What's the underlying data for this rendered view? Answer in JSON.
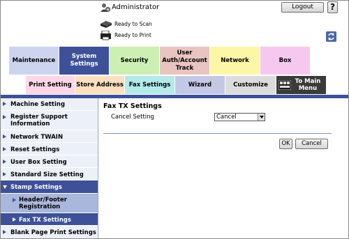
{
  "header": {
    "user_name": "Administrator",
    "logout_label": "Logout",
    "help_label": "?",
    "status": [
      {
        "text": "Ready to Scan",
        "icon": "scanner-icon"
      },
      {
        "text": "Ready to Print",
        "icon": "printer-icon"
      }
    ]
  },
  "categories": [
    {
      "label": "Maintenance",
      "bg": "#ccd4f0",
      "color": "#000000"
    },
    {
      "label": "System Settings",
      "bg": "#3d5098",
      "color": "#ffffff"
    },
    {
      "label": "Security",
      "bg": "#ccf0b4",
      "color": "#000000"
    },
    {
      "label": "User Auth/Account Track",
      "bg": "#e8c5c1",
      "color": "#000000"
    },
    {
      "label": "Network",
      "bg": "#fcf7a6",
      "color": "#000000"
    },
    {
      "label": "Box",
      "bg": "#f7c8ef",
      "color": "#000000"
    }
  ],
  "subtabs": [
    {
      "label": "Print Setting",
      "bg": "#fcd6e8",
      "color": "#000000"
    },
    {
      "label": "Store Address",
      "bg": "#fce0c0",
      "color": "#000000"
    },
    {
      "label": "Fax Settings",
      "bg": "#b4eaea",
      "color": "#000000"
    },
    {
      "label": "Wizard",
      "bg": "#c4c8e4",
      "color": "#000000"
    },
    {
      "label": "Customize",
      "bg": "#dcdcdc",
      "color": "#000000"
    },
    {
      "label": "To Main Menu",
      "bg": "#3a3a3a",
      "color": "#ffffff"
    }
  ],
  "sidebar": {
    "items": [
      {
        "label": "Machine Setting"
      },
      {
        "label": "Register Support Information"
      },
      {
        "label": "Network TWAIN"
      },
      {
        "label": "Reset Settings"
      },
      {
        "label": "User Box Setting"
      },
      {
        "label": "Standard Size Setting"
      },
      {
        "label": "Stamp Settings"
      },
      {
        "label": "Header/Footer Registration"
      },
      {
        "label": "Fax TX Settings"
      },
      {
        "label": "Blank Page Print Settings"
      }
    ]
  },
  "main": {
    "section_title": "Fax TX Settings",
    "cancel_setting_label": "Cancel Setting",
    "cancel_setting_value": "Cancel",
    "ok_label": "OK",
    "cancel_label": "Cancel"
  },
  "colors": {
    "accent": "#3d5098",
    "sidebar_bg": "#ecf1f9",
    "sidebar_child_bg": "#a9b7dc"
  }
}
